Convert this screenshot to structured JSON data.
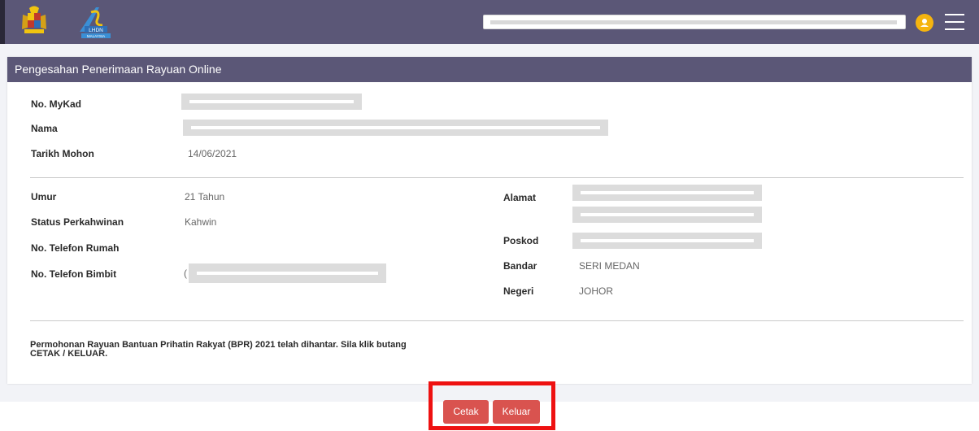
{
  "header": {
    "logo_text": "LHDN",
    "logo_subtext": "MALAYSIA"
  },
  "card": {
    "title": "Pengesahan Penerimaan Rayuan Online"
  },
  "applicant": {
    "mykad_label": "No. MyKad",
    "nama_label": "Nama",
    "tarikh_label": "Tarikh Mohon",
    "tarikh_value": "14/06/2021"
  },
  "details": {
    "umur_label": "Umur",
    "umur_value": "21 Tahun",
    "status_label": "Status Perkahwinan",
    "status_value": "Kahwin",
    "telefon_rumah_label": "No. Telefon Rumah",
    "telefon_bimbit_label": "No. Telefon Bimbit",
    "telefon_bimbit_prefix": "(",
    "alamat_label": "Alamat",
    "poskod_label": "Poskod",
    "bandar_label": "Bandar",
    "bandar_value": "SERI MEDAN",
    "negeri_label": "Negeri",
    "negeri_value": "JOHOR"
  },
  "message": "Permohonan Rayuan Bantuan Prihatin Rakyat (BPR) 2021 telah dihantar. Sila klik butang CETAK / KELUAR.",
  "buttons": {
    "print_label": "Cetak",
    "exit_label": "Keluar"
  },
  "colors": {
    "header_bg": "#5b5777",
    "button_bg": "#d9534f",
    "highlight": "#ee1111",
    "user_icon": "#f5b40f"
  },
  "icons": [
    "jata-negara-crest",
    "lhdn-logo",
    "user-icon",
    "menu-icon"
  ]
}
